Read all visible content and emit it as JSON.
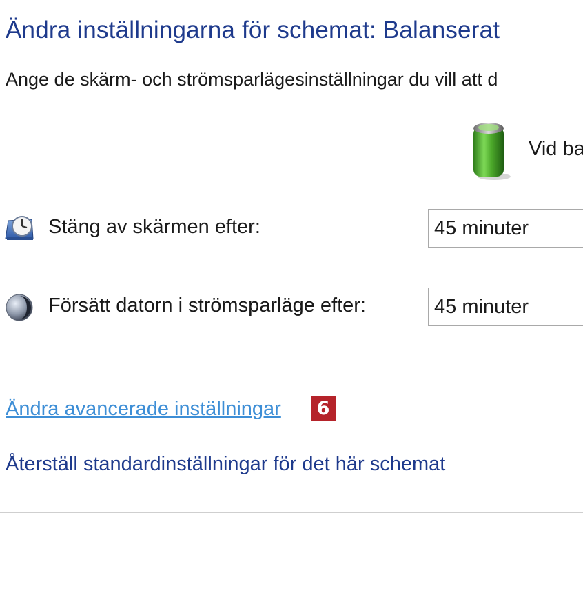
{
  "header": {
    "title": "Ändra inställningarna för schemat: Balanserat",
    "subtitle": "Ange de skärm- och strömsparlägesinställningar du vill att d"
  },
  "columns": {
    "battery_label": "Vid ba",
    "battery_icon": "battery-icon"
  },
  "settings": [
    {
      "label": "Stäng av skärmen efter:",
      "value": "45 minuter",
      "icon": "monitor-clock-icon"
    },
    {
      "label": "Försätt datorn i strömsparläge efter:",
      "value": "45 minuter",
      "icon": "moon-sleep-icon"
    }
  ],
  "links": {
    "advanced": "Ändra avancerade inställningar",
    "badge": "6",
    "reset": "Återställ standardinställningar för det här schemat"
  },
  "colors": {
    "title": "#1e3a8c",
    "link": "#3d8ed6",
    "badge": "#b5232a"
  }
}
